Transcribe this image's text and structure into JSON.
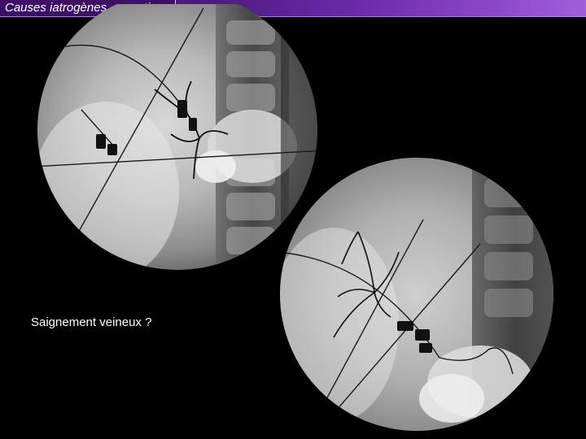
{
  "slide": {
    "title": "Causes iatrogènes - ponctions",
    "caption": "Saignement veineux ?"
  },
  "colors": {
    "background": "#000000",
    "title_bar_start": "#3a1460",
    "title_bar_end": "#a060dc",
    "text": "#ffffff"
  },
  "images": [
    {
      "name": "fluoroscopy-image-1",
      "description_type": "radiograph"
    },
    {
      "name": "fluoroscopy-image-2",
      "description_type": "radiograph"
    }
  ]
}
